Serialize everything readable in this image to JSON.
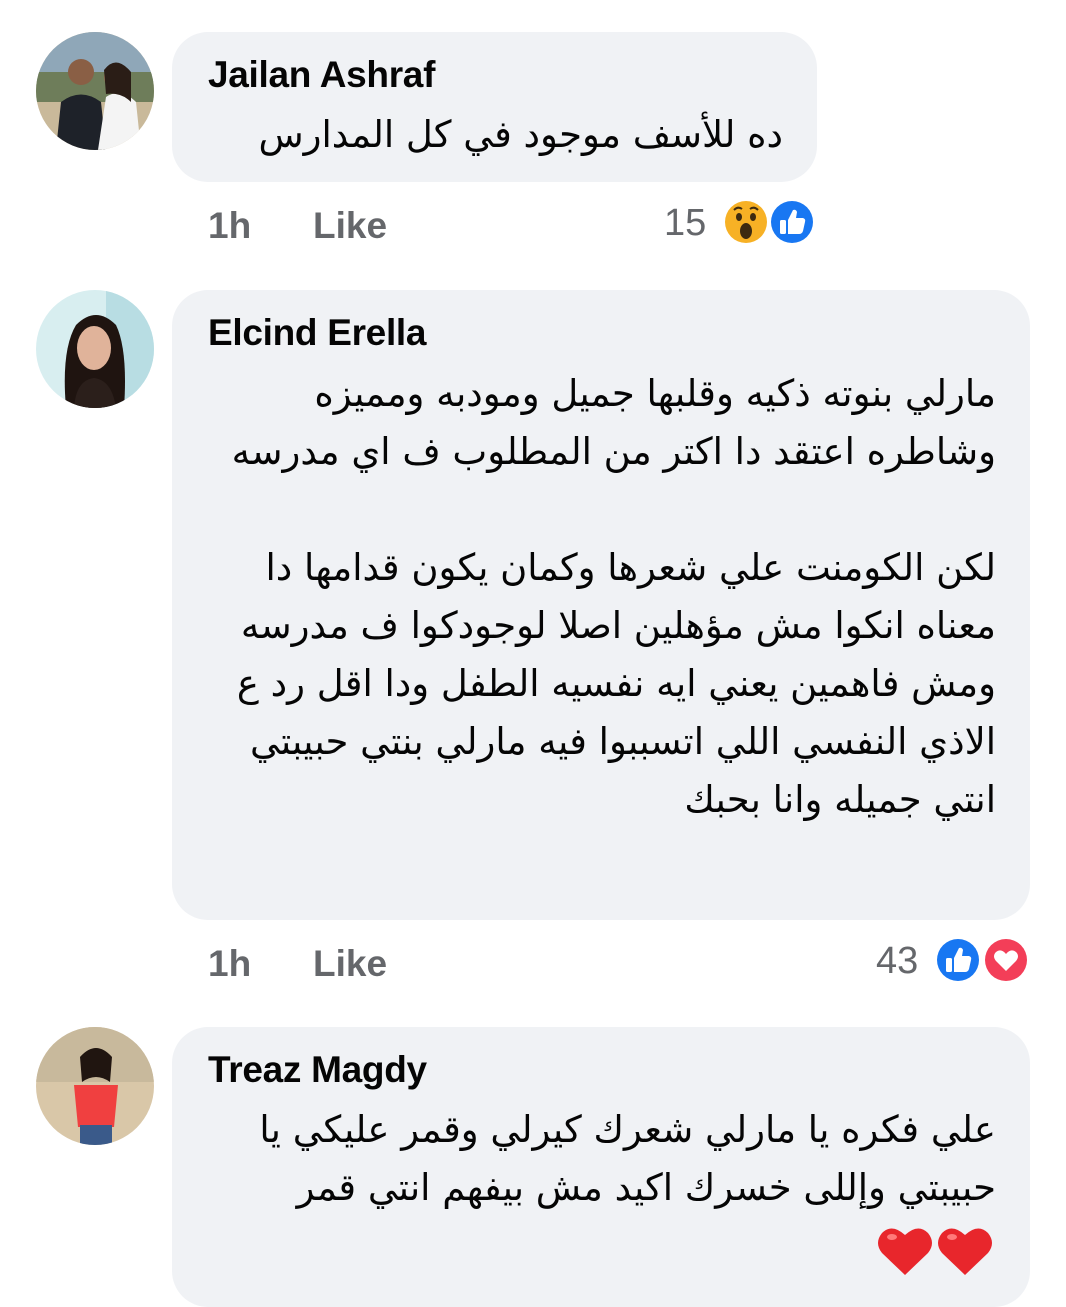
{
  "comments": [
    {
      "author": "Jailan Ashraf",
      "text": "ده للأسف موجود في كل المدارس",
      "time": "1h",
      "like_label": "Like",
      "reaction_count": "15",
      "reactions": [
        "wow-reaction-icon",
        "like-reaction-icon"
      ]
    },
    {
      "author": "Elcind Erella",
      "text": "مارلي بنوته ذكيه وقلبها جميل ومودبه ومميزه وشاطره اعتقد دا اكتر من المطلوب ف اي مدرسه\n\nلكن الكومنت علي شعرها وكمان يكون قدامها دا معناه انكوا مش مؤهلين اصلا لوجودكوا ف مدرسه ومش فاهمين يعني ايه نفسيه الطفل ودا اقل رد ع الاذي النفسي اللي اتسببوا فيه مارلي بنتي حبيبتي انتي جميله وانا بحبك",
      "time": "1h",
      "like_label": "Like",
      "reaction_count": "43",
      "reactions": [
        "like-reaction-icon",
        "love-reaction-icon"
      ]
    },
    {
      "author": "Treaz Magdy",
      "text": "علي فكره يا مارلي شعرك كيرلي وقمر عليكي يا حبيبتي وإللى خسرك اكيد مش بيفهم انتي قمر",
      "emoji": [
        "red-heart-emoji",
        "red-heart-emoji"
      ]
    }
  ],
  "colors": {
    "bubble": "#f0f2f5",
    "meta_text": "#65676b",
    "like_blue": "#1877f2",
    "love_red": "#f33e58",
    "wow_yellow": "#f7b125"
  }
}
